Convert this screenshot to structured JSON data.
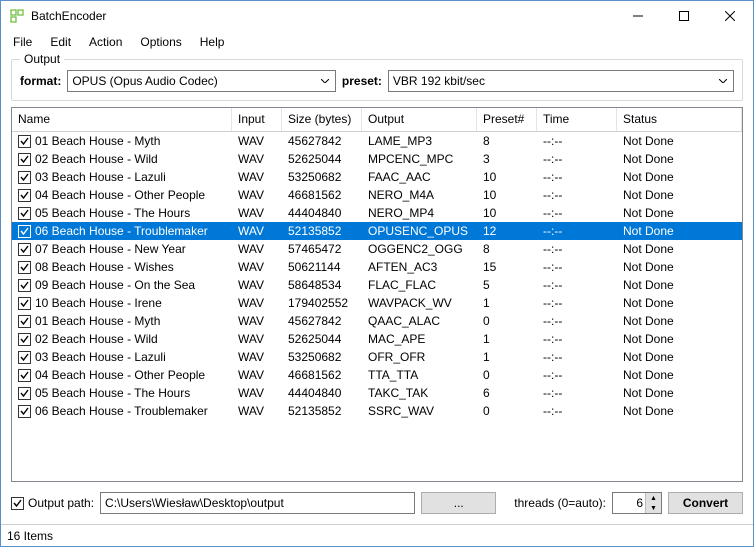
{
  "window": {
    "title": "BatchEncoder",
    "icon_color": "#6fbf3f"
  },
  "menu": {
    "items": [
      "File",
      "Edit",
      "Action",
      "Options",
      "Help"
    ]
  },
  "output_group": {
    "legend": "Output",
    "format_label": "format:",
    "format_value": "OPUS (Opus Audio Codec)",
    "preset_label": "preset:",
    "preset_value": "VBR 192 kbit/sec"
  },
  "table": {
    "columns": [
      "Name",
      "Input",
      "Size (bytes)",
      "Output",
      "Preset#",
      "Time",
      "Status"
    ],
    "rows": [
      {
        "checked": true,
        "name": "01 Beach House - Myth",
        "input": "WAV",
        "size": "45627842",
        "output": "LAME_MP3",
        "preset": "8",
        "time": "--:--",
        "status": "Not Done"
      },
      {
        "checked": true,
        "name": "02 Beach House - Wild",
        "input": "WAV",
        "size": "52625044",
        "output": "MPCENC_MPC",
        "preset": "3",
        "time": "--:--",
        "status": "Not Done"
      },
      {
        "checked": true,
        "name": "03 Beach House - Lazuli",
        "input": "WAV",
        "size": "53250682",
        "output": "FAAC_AAC",
        "preset": "10",
        "time": "--:--",
        "status": "Not Done"
      },
      {
        "checked": true,
        "name": "04 Beach House - Other People",
        "input": "WAV",
        "size": "46681562",
        "output": "NERO_M4A",
        "preset": "10",
        "time": "--:--",
        "status": "Not Done"
      },
      {
        "checked": true,
        "name": "05 Beach House - The Hours",
        "input": "WAV",
        "size": "44404840",
        "output": "NERO_MP4",
        "preset": "10",
        "time": "--:--",
        "status": "Not Done"
      },
      {
        "checked": true,
        "name": "06 Beach House - Troublemaker",
        "input": "WAV",
        "size": "52135852",
        "output": "OPUSENC_OPUS",
        "preset": "12",
        "time": "--:--",
        "status": "Not Done",
        "selected": true
      },
      {
        "checked": true,
        "name": "07 Beach House - New Year",
        "input": "WAV",
        "size": "57465472",
        "output": "OGGENC2_OGG",
        "preset": "8",
        "time": "--:--",
        "status": "Not Done"
      },
      {
        "checked": true,
        "name": "08 Beach House - Wishes",
        "input": "WAV",
        "size": "50621144",
        "output": "AFTEN_AC3",
        "preset": "15",
        "time": "--:--",
        "status": "Not Done"
      },
      {
        "checked": true,
        "name": "09 Beach House - On the Sea",
        "input": "WAV",
        "size": "58648534",
        "output": "FLAC_FLAC",
        "preset": "5",
        "time": "--:--",
        "status": "Not Done"
      },
      {
        "checked": true,
        "name": "10 Beach House - Irene",
        "input": "WAV",
        "size": "179402552",
        "output": "WAVPACK_WV",
        "preset": "1",
        "time": "--:--",
        "status": "Not Done"
      },
      {
        "checked": true,
        "name": "01 Beach House - Myth",
        "input": "WAV",
        "size": "45627842",
        "output": "QAAC_ALAC",
        "preset": "0",
        "time": "--:--",
        "status": "Not Done"
      },
      {
        "checked": true,
        "name": "02 Beach House - Wild",
        "input": "WAV",
        "size": "52625044",
        "output": "MAC_APE",
        "preset": "1",
        "time": "--:--",
        "status": "Not Done"
      },
      {
        "checked": true,
        "name": "03 Beach House - Lazuli",
        "input": "WAV",
        "size": "53250682",
        "output": "OFR_OFR",
        "preset": "1",
        "time": "--:--",
        "status": "Not Done"
      },
      {
        "checked": true,
        "name": "04 Beach House - Other People",
        "input": "WAV",
        "size": "46681562",
        "output": "TTA_TTA",
        "preset": "0",
        "time": "--:--",
        "status": "Not Done"
      },
      {
        "checked": true,
        "name": "05 Beach House - The Hours",
        "input": "WAV",
        "size": "44404840",
        "output": "TAKC_TAK",
        "preset": "6",
        "time": "--:--",
        "status": "Not Done"
      },
      {
        "checked": true,
        "name": "06 Beach House - Troublemaker",
        "input": "WAV",
        "size": "52135852",
        "output": "SSRC_WAV",
        "preset": "0",
        "time": "--:--",
        "status": "Not Done"
      }
    ]
  },
  "bottom": {
    "output_path_label": "Output path:",
    "output_path_value": "C:\\Users\\Wiesław\\Desktop\\output",
    "browse_label": "...",
    "threads_label": "threads (0=auto):",
    "threads_value": "6",
    "convert_label": "Convert"
  },
  "status": {
    "text": "16 Items"
  }
}
